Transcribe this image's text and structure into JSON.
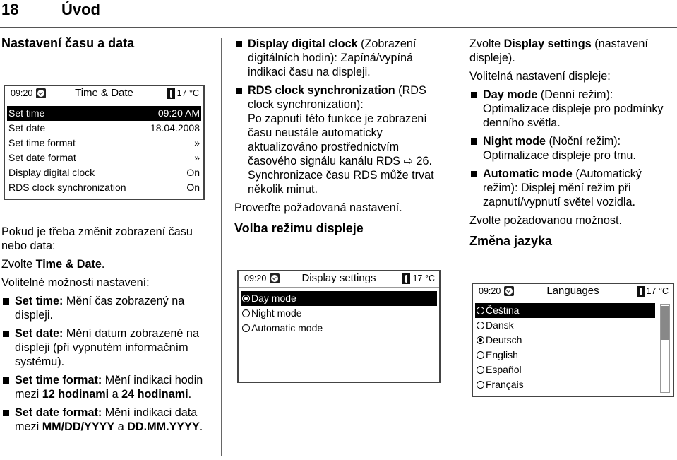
{
  "header": {
    "page_number": "18",
    "chapter": "Úvod"
  },
  "left": {
    "heading": "Nastavení času a data",
    "screen": {
      "time": "09:20",
      "title": "Time & Date",
      "temp": "17 °C",
      "rows": [
        {
          "label": "Set time",
          "value": "09:20 AM",
          "selected": true
        },
        {
          "label": "Set date",
          "value": "18.04.2008"
        },
        {
          "label": "Set time format",
          "value": "»"
        },
        {
          "label": "Set date format",
          "value": "»"
        },
        {
          "label": "Display digital clock",
          "value": "On"
        },
        {
          "label": "RDS clock synchronization",
          "value": "On"
        }
      ]
    },
    "intro": "Pokud je třeba změnit zobrazení času nebo data:",
    "select_prefix": "Zvolte ",
    "select_bold": "Time & Date",
    "select_suffix": ".",
    "options_label": "Volitelné možnosti nastavení:",
    "bullets": [
      {
        "bold": "Set time:",
        "text": " Mění čas zobrazený na displeji."
      },
      {
        "bold": "Set date:",
        "text": " Mění datum zobrazené na displeji (při vypnutém informačním systému)."
      },
      {
        "bold": "Set time format:",
        "text": " Mění indikaci hodin mezi ",
        "bold2": "12 hodinami",
        "text2": " a ",
        "bold3": "24 hodinami",
        "text3": "."
      },
      {
        "bold": "Set date format:",
        "text": " Mění indikaci data mezi ",
        "bold2": "MM/DD/YYYY",
        "text2": " a ",
        "bold3": "DD.MM.YYYY",
        "text3": "."
      }
    ]
  },
  "middle": {
    "bullets": [
      {
        "bold": "Display digital clock",
        "text": " (Zobrazení digitálních hodin): Zapíná/vypíná indikaci času na displeji."
      },
      {
        "bold": "RDS clock synchronization",
        "text": " (RDS clock synchronization):",
        "text2": "Po zapnutí této funkce je zobrazení času neustále automaticky aktualizováno prostřednictvím časového signálu kanálu RDS ",
        "ref": "26",
        "text3": ". Synchronizace času RDS může trvat několik minut."
      }
    ],
    "apply": "Proveďte požadovaná nastavení.",
    "heading": "Volba režimu displeje",
    "screen": {
      "time": "09:20",
      "title": "Display settings",
      "temp": "17 °C",
      "rows": [
        {
          "label": "Day mode",
          "checked": true,
          "selected": true
        },
        {
          "label": "Night mode",
          "checked": false
        },
        {
          "label": "Automatic mode",
          "checked": false
        }
      ]
    }
  },
  "right": {
    "select_prefix": "Zvolte ",
    "select_bold": "Display settings",
    "select_suffix": " (nastavení displeje).",
    "options_label": "Volitelná nastavení displeje:",
    "bullets": [
      {
        "bold": "Day mode",
        "text": " (Denní režim): Optimalizace displeje pro podmínky denního světla."
      },
      {
        "bold": "Night mode",
        "text": " (Noční režim): Optimalizace displeje pro tmu."
      },
      {
        "bold": "Automatic mode",
        "text": " (Automatický režim): Displej mění režim při zapnutí/vypnutí světel vozidla."
      }
    ],
    "choose": "Zvolte požadovanou možnost.",
    "heading": "Změna jazyka",
    "screen": {
      "time": "09:20",
      "title": "Languages",
      "temp": "17 °C",
      "rows": [
        {
          "label": "Čeština",
          "checked": false,
          "selected": true
        },
        {
          "label": "Dansk",
          "checked": false
        },
        {
          "label": "Deutsch",
          "checked": true
        },
        {
          "label": "English",
          "checked": false
        },
        {
          "label": "Español",
          "checked": false
        },
        {
          "label": "Français",
          "checked": false
        }
      ],
      "scroll_position": 0.0,
      "scroll_visible_fraction": 0.4
    }
  }
}
